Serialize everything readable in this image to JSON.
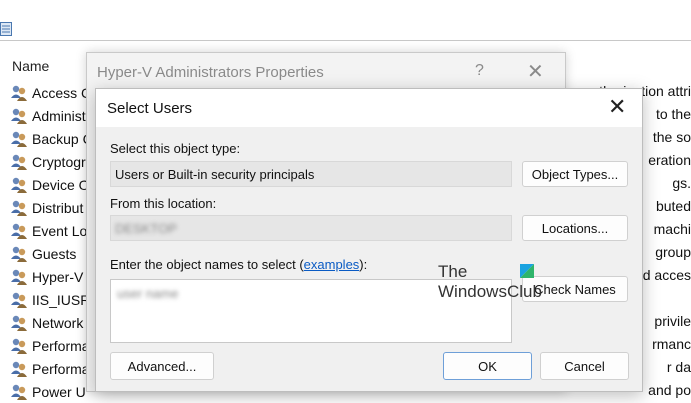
{
  "background": {
    "column_header": "Name",
    "rows": [
      {
        "name": "Access C",
        "desc": "uthorization attri"
      },
      {
        "name": "Administ",
        "desc": "to the"
      },
      {
        "name": "Backup C",
        "desc": "the so"
      },
      {
        "name": "Cryptogr",
        "desc": "eration"
      },
      {
        "name": "Device O",
        "desc": "gs."
      },
      {
        "name": "Distribut",
        "desc": "buted"
      },
      {
        "name": "Event Lo",
        "desc": "machi"
      },
      {
        "name": "Guests",
        "desc": "group"
      },
      {
        "name": "Hyper-V",
        "desc": "d acces"
      },
      {
        "name": "IIS_IUSR",
        "desc": ""
      },
      {
        "name": "Network",
        "desc": "privile"
      },
      {
        "name": "Performa",
        "desc": "rmanc"
      },
      {
        "name": "Performa",
        "desc": "r da"
      },
      {
        "name": "Power U",
        "desc": "and po"
      }
    ]
  },
  "properties_dialog": {
    "title": "Hyper-V Administrators Properties",
    "help_glyph": "?",
    "close_glyph": "✕"
  },
  "select_users": {
    "title": "Select Users",
    "close_glyph": "✕",
    "object_type_label": "Select this object type:",
    "object_type_value": "Users or Built-in security principals",
    "object_types_button": "Object Types...",
    "location_label": "From this location:",
    "location_value": "DESKTOP",
    "locations_button": "Locations...",
    "names_label_prefix": "Enter the object names to select (",
    "names_label_link": "examples",
    "names_label_suffix": "):",
    "names_value": "user name",
    "check_names_button": "Check Names",
    "advanced_button": "Advanced...",
    "ok_button": "OK",
    "cancel_button": "Cancel"
  },
  "watermark": {
    "line1": "The",
    "line2": "WindowsClub"
  },
  "colors": {
    "accent": "#0a5bc4",
    "dialog_bg": "#f0f0f0"
  }
}
